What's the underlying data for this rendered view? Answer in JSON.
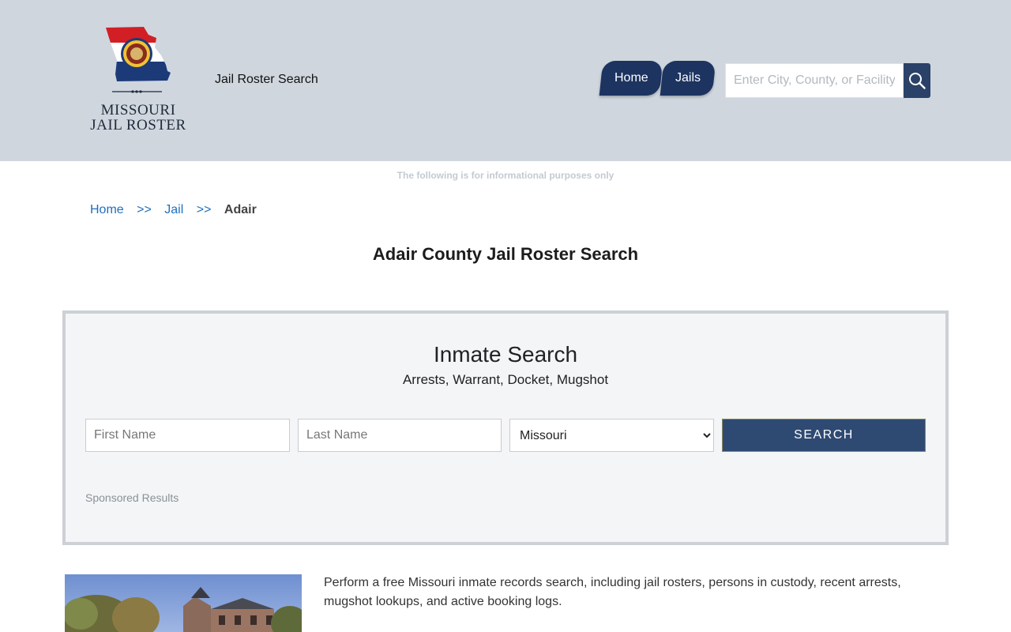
{
  "header": {
    "logo_line1": "MISSOURI",
    "logo_line2": "JAIL ROSTER",
    "tagline": "Jail Roster Search",
    "nav": [
      {
        "label": "Home"
      },
      {
        "label": "Jails"
      }
    ],
    "search_placeholder": "Enter City, County, or Facility",
    "search_icon": "search-icon",
    "bg_color": "#cfd6de",
    "nav_color": "#1d3461"
  },
  "disclaimer": "The following is for informational purposes only",
  "breadcrumb": {
    "items": [
      "Home",
      "Jail"
    ],
    "separator": ">>",
    "current": "Adair"
  },
  "page_title": "Adair County Jail Roster Search",
  "inmate_search": {
    "heading": "Inmate Search",
    "subheading": "Arrests, Warrant, Docket, Mugshot",
    "first_name_placeholder": "First Name",
    "last_name_placeholder": "Last Name",
    "state_selected": "Missouri",
    "button_label": "SEARCH",
    "sponsored": "Sponsored Results",
    "button_color": "#2f4a72"
  },
  "intro_text": "Perform a free Missouri inmate records search, including jail rosters, persons in custody, recent arrests, mugshot lookups, and active booking logs."
}
